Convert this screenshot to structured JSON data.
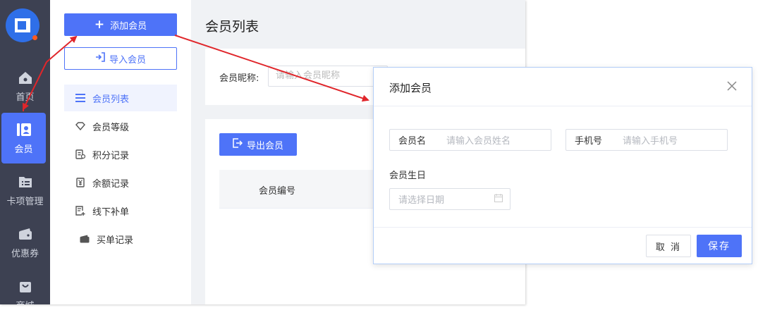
{
  "rail": {
    "items": [
      {
        "label": "首页",
        "icon": "home-icon"
      },
      {
        "label": "会员",
        "icon": "member-card-icon"
      },
      {
        "label": "卡项管理",
        "icon": "folder-list-icon"
      },
      {
        "label": "优惠券",
        "icon": "wallet-icon"
      },
      {
        "label": "商城",
        "icon": "shopping-bag-icon"
      }
    ]
  },
  "subnav": {
    "add_label": "添加会员",
    "import_label": "导入会员",
    "items": [
      {
        "label": "会员列表",
        "icon": "list-icon"
      },
      {
        "label": "会员等级",
        "icon": "diamond-icon"
      },
      {
        "label": "积分记录",
        "icon": "points-icon"
      },
      {
        "label": "余额记录",
        "icon": "yen-icon"
      },
      {
        "label": "线下补单",
        "icon": "add-document-icon"
      },
      {
        "label": "买单记录",
        "icon": "wallet-icon"
      }
    ]
  },
  "main": {
    "title": "会员列表",
    "filter_label": "会员昵称:",
    "filter_placeholder": "请输入会员昵称",
    "export_label": "导出会员",
    "col_member_no": "会员编号"
  },
  "dialog": {
    "title": "添加会员",
    "name_label": "会员名",
    "name_placeholder": "请输入会员姓名",
    "phone_label": "手机号",
    "phone_placeholder": "请输入手机号",
    "birthday_label": "会员生日",
    "date_placeholder": "请选择日期",
    "cancel_label": "取 消",
    "save_label": "保存"
  },
  "colors": {
    "accent": "#4e73f8",
    "rail_bg": "#3d4152",
    "arrow": "#e0262b"
  }
}
